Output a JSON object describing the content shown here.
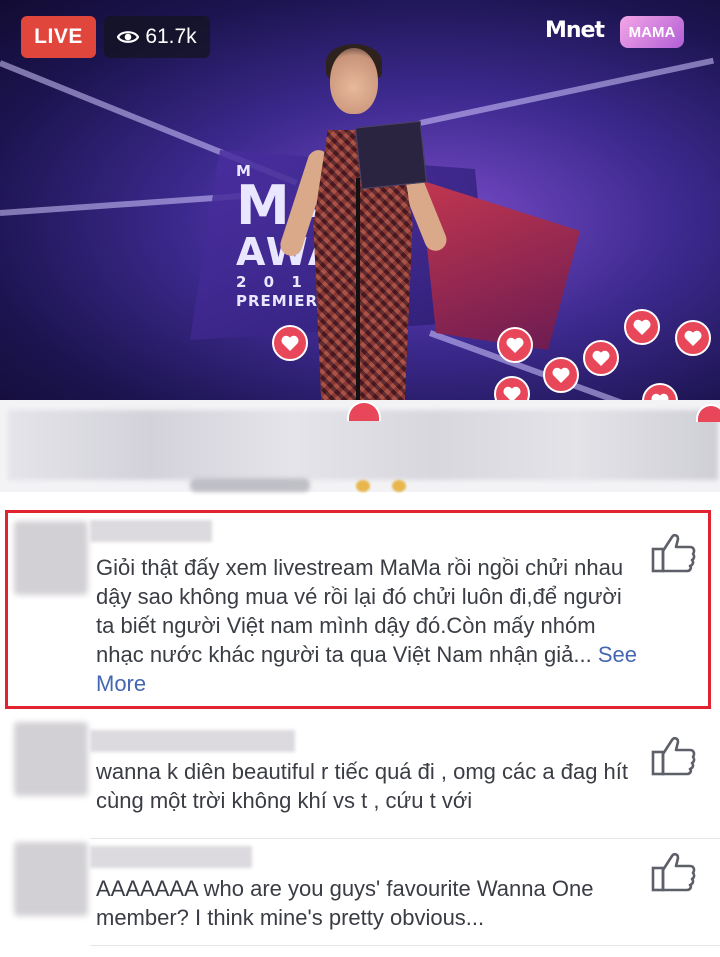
{
  "live_stream": {
    "live_label": "LIVE",
    "viewer_count": "61.7k",
    "channel_logo": "Mnet",
    "event_logo": "MAMA",
    "stage_text": {
      "line1": "M",
      "line2": "MA",
      "line3": "AWA",
      "year": "2 0 1 7",
      "premiere": "PREMIER"
    },
    "accent_colors": {
      "live": "#e0463c",
      "heart": "#e8475a",
      "highlight": "#e0232e",
      "link": "#4567b2"
    }
  },
  "comments": [
    {
      "text": "Giỏi thật đấy xem livestream MaMa rồi ngồi chửi nhau dậy sao không mua vé rồi lại đó chửi luôn đi,để người ta biết người Việt nam mình dậy đó.Còn mấy nhóm nhạc nước khác người ta qua Việt Nam nhận giả...",
      "see_more": "See More",
      "highlighted": true
    },
    {
      "text": "wanna k diên beautiful r tiếc quá đi , omg các a đag hít cùng một trời không khí vs t , cứu t với",
      "highlighted": false
    },
    {
      "text": "AAAAAAA who are you guys' favourite Wanna One member? I think mine's pretty obvious...",
      "highlighted": false
    }
  ],
  "icons": {
    "like": "thumbs-up-icon",
    "viewer": "eye-icon",
    "reaction": "heart-icon"
  }
}
